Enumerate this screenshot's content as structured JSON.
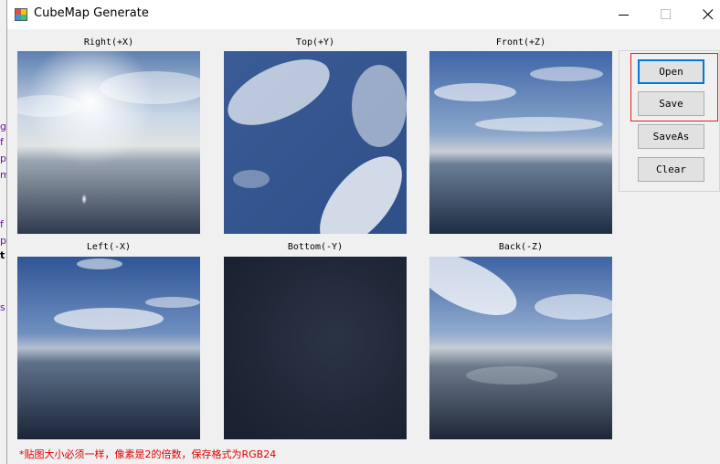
{
  "window": {
    "title": "CubeMap Generate",
    "icon": "app-icon",
    "controls": [
      "minimize-icon",
      "maximize-icon",
      "close-icon"
    ]
  },
  "faces": [
    {
      "caption": "Right(+X)",
      "name": "right"
    },
    {
      "caption": "Top(+Y)",
      "name": "top"
    },
    {
      "caption": "Front(+Z)",
      "name": "front"
    },
    {
      "caption": "Left(-X)",
      "name": "left"
    },
    {
      "caption": "Bottom(-Y)",
      "name": "bottom"
    },
    {
      "caption": "Back(-Z)",
      "name": "back"
    }
  ],
  "buttons": {
    "open": "Open",
    "save": "Save",
    "saveas": "SaveAs",
    "clear": "Clear"
  },
  "note": "*贴图大小必须一样，像素是2的倍数，保存格式为RGB24",
  "background_fragments": [
    "g",
    "f",
    "p",
    "m",
    "f",
    "p",
    "t",
    "s"
  ],
  "colors": {
    "highlight_border": "#e02020",
    "default_button_border": "#0078d7",
    "note_text": "#e00000",
    "fragment_text": "#6a0dad"
  }
}
